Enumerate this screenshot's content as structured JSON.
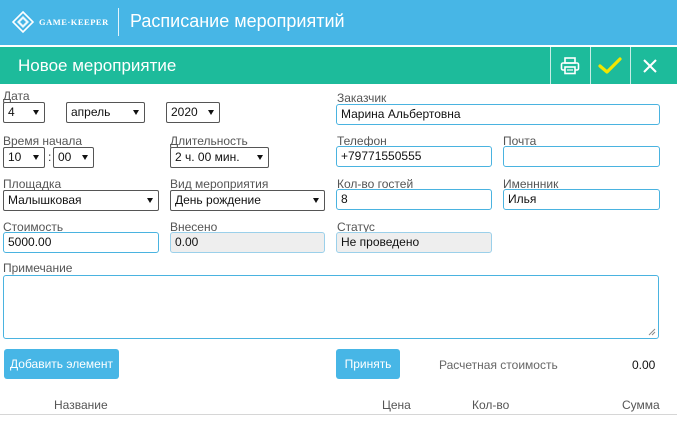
{
  "header": {
    "logo_text": "GAME·KEEPER",
    "title": "Расписание мероприятий"
  },
  "subheader": {
    "title": "Новое мероприятие",
    "icons": [
      "printer-icon",
      "checkmark-icon",
      "close-icon"
    ]
  },
  "form": {
    "date": {
      "label": "Дата",
      "day": "4",
      "month": "апрель",
      "year": "2020"
    },
    "customer": {
      "label": "Заказчик",
      "value": "Марина Альбертовна"
    },
    "start_time": {
      "label": "Время начала",
      "hour": "10",
      "minute": "00"
    },
    "duration": {
      "label": "Длительность",
      "value": "2 ч. 00 мин."
    },
    "phone": {
      "label": "Телефон",
      "value": "+79771550555"
    },
    "email": {
      "label": "Почта",
      "value": ""
    },
    "venue": {
      "label": "Площадка",
      "value": "Малышковая"
    },
    "event_type": {
      "label": "Вид мероприятия",
      "value": "День рождение"
    },
    "guests": {
      "label": "Кол-во гостей",
      "value": "8"
    },
    "birthday_person": {
      "label": "Именнник",
      "value": "Илья"
    },
    "cost": {
      "label": "Стоимость",
      "value": "5000.00"
    },
    "paid": {
      "label": "Внесено",
      "value": "0.00"
    },
    "status": {
      "label": "Статус",
      "value": "Не проведено"
    },
    "note": {
      "label": "Примечание",
      "value": ""
    }
  },
  "actions": {
    "add_element": "Добавить элемент",
    "accept": "Принять",
    "calc_cost_label": "Расчетная стоимость",
    "calc_cost_value": "0.00"
  },
  "table": {
    "columns": [
      "Название",
      "Цена",
      "Кол-во",
      "Сумма"
    ]
  },
  "colors": {
    "header_blue": "#47b6e6",
    "subheader_green": "#1dbb9b",
    "field_border": "#4ab3e0",
    "check_yellow": "#f2e600"
  }
}
